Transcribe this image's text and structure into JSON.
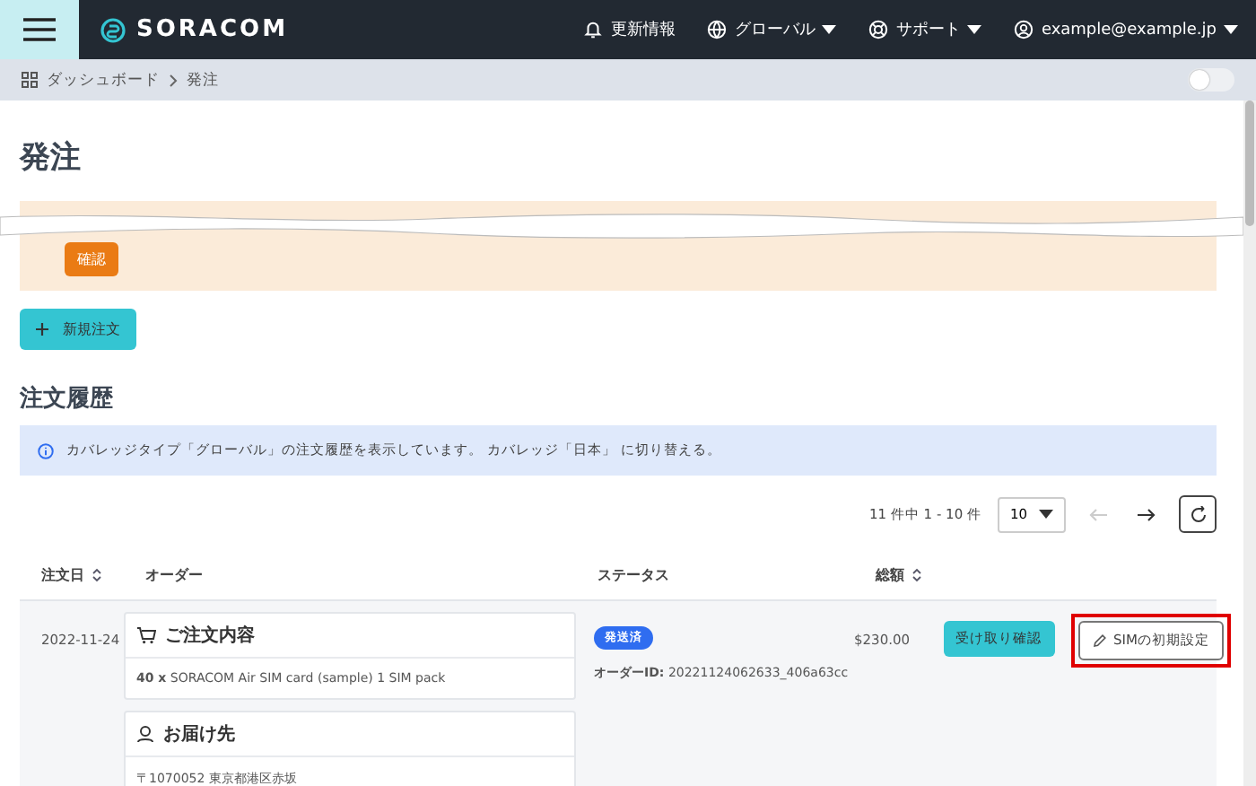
{
  "header": {
    "logo": "SORACOM",
    "nav": [
      {
        "kind": "bell",
        "label": "更新情報",
        "caret": false
      },
      {
        "kind": "globe",
        "label": "グローバル",
        "caret": true
      },
      {
        "kind": "support",
        "label": "サポート",
        "caret": true
      },
      {
        "kind": "user",
        "label": "example@example.jp",
        "caret": true
      }
    ]
  },
  "breadcrumb": [
    "ダッシュボード",
    "発注"
  ],
  "theme_toggle": {
    "on": false
  },
  "page_title": "発注",
  "notice": {
    "button": "確認"
  },
  "new_order_button": "新規注文",
  "section_title": "注文履歴",
  "info_banner": "カバレッジタイプ「グローバル」の注文履歴を表示しています。 カバレッジ「日本」 に切り替える。",
  "pagination": {
    "range": "11 件中 1 - 10 件",
    "page_size": "10",
    "prev_disabled": true,
    "next_disabled": false
  },
  "table": {
    "columns": [
      {
        "label": "注文日",
        "sortable": true
      },
      {
        "label": "オーダー",
        "sortable": false
      },
      {
        "label": "ステータス",
        "sortable": false
      },
      {
        "label": "総額",
        "sortable": true
      }
    ],
    "rows": [
      {
        "date": "2022-11-24",
        "order_card": {
          "title": "ご注文内容",
          "item": "**40 x** SORACOM Air SIM card (sample) 1 SIM pack"
        },
        "delivery_card": {
          "title": "お届け先",
          "address": "〒1070052 東京都港区赤坂"
        },
        "status": "発送済",
        "order_id": "**オーダーID:** 20221124062633_406a63cc",
        "total": "$230.00",
        "actions": [
          {
            "label": "受け取り確認",
            "kind": "primary",
            "highlighted": false
          },
          {
            "label": "SIMの初期設定",
            "kind": "outline",
            "highlighted": true
          }
        ]
      }
    ]
  }
}
